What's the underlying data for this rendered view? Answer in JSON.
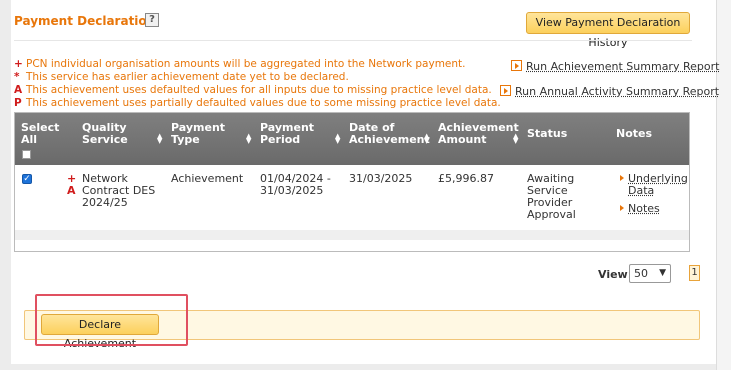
{
  "header": {
    "title": "Payment Declaration",
    "help_label": "?",
    "history_button": "View Payment Declaration History"
  },
  "legend": [
    {
      "mark": "+",
      "text": "PCN individual organisation amounts will be aggregated into the Network payment."
    },
    {
      "mark": "*",
      "text": "This service has earlier achievement date yet to be declared."
    },
    {
      "mark": "A",
      "text": "This achievement uses defaulted values for all inputs due to missing practice level data."
    },
    {
      "mark": "P",
      "text": "This achievement uses partially defaulted values due to some missing practice level data."
    }
  ],
  "reports": {
    "achievement_summary": "Run Achievement Summary Report",
    "annual_activity_summary": "Run Annual Activity Summary Report"
  },
  "table": {
    "columns": {
      "select_all": [
        "Select",
        "All"
      ],
      "quality_service": [
        "Quality",
        "Service"
      ],
      "payment_type": [
        "Payment",
        "Type"
      ],
      "payment_period": [
        "Payment",
        "Period"
      ],
      "date_of_achievement": [
        "Date of",
        "Achievement"
      ],
      "achievement_amount": [
        "Achievement",
        "Amount"
      ],
      "status": [
        "Status"
      ],
      "notes": [
        "Notes"
      ]
    },
    "rows": [
      {
        "checked": true,
        "marks": [
          "+",
          "A"
        ],
        "quality_service": [
          "Network",
          "Contract DES",
          "2024/25"
        ],
        "payment_type": "Achievement",
        "payment_period": [
          "01/04/2024 -",
          "31/03/2025"
        ],
        "date_of_achievement": "31/03/2025",
        "achievement_amount": "£5,996.87",
        "status": [
          "Awaiting",
          "Service",
          "Provider",
          "Approval"
        ],
        "notes_links": [
          "Underlying",
          "Data",
          "Notes"
        ]
      }
    ]
  },
  "pagination": {
    "view_label": "View:",
    "page_size": "50",
    "current_page": "1"
  },
  "actions": {
    "declare_button": "Declare Achievement"
  },
  "colors": {
    "accent_orange": "#e8760a",
    "mark_red": "#d01c1c",
    "header_grey": "#737373",
    "button_yellow": "#fcd05c",
    "highlight_red": "#e05060"
  }
}
